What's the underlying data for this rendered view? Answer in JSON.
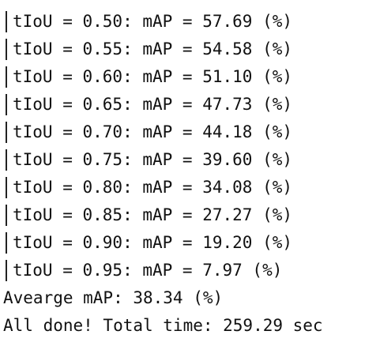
{
  "terminal": {
    "results": [
      "tIoU = 0.50: mAP = 57.69 (%)",
      "tIoU = 0.55: mAP = 54.58 (%)",
      "tIoU = 0.60: mAP = 51.10 (%)",
      "tIoU = 0.65: mAP = 47.73 (%)",
      "tIoU = 0.70: mAP = 44.18 (%)",
      "tIoU = 0.75: mAP = 39.60 (%)",
      "tIoU = 0.80: mAP = 34.08 (%)",
      "tIoU = 0.85: mAP = 27.27 (%)",
      "tIoU = 0.90: mAP = 19.20 (%)",
      "tIoU = 0.95: mAP = 7.97 (%)"
    ],
    "average_line": "Avearge mAP: 38.34 (%)",
    "done_line": "All done! Total time: 259.29 sec"
  }
}
